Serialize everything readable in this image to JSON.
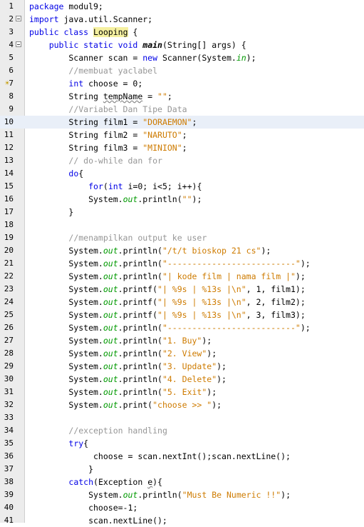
{
  "gutter": {
    "numbers": [
      "1",
      "2",
      "3",
      "4",
      "5",
      "6",
      "7",
      "8",
      "9",
      "10",
      "11",
      "12",
      "13",
      "14",
      "15",
      "16",
      "17",
      "18",
      "19",
      "20",
      "21",
      "22",
      "23",
      "24",
      "25",
      "26",
      "27",
      "28",
      "29",
      "30",
      "31",
      "32",
      "33",
      "34",
      "35",
      "36",
      "37",
      "38",
      "39",
      "40",
      "41"
    ]
  },
  "editor": {
    "highlighted_line": 10,
    "lines": [
      [
        [
          "kw",
          "package"
        ],
        [
          "tx",
          " modul9;"
        ]
      ],
      [
        [
          "kw",
          "import"
        ],
        [
          "tx",
          " java.util.Scanner;"
        ]
      ],
      [
        [
          "kw",
          "public class"
        ],
        [
          "tx",
          " "
        ],
        [
          "hc",
          "Looping"
        ],
        [
          "tx",
          " {"
        ]
      ],
      [
        [
          "tx",
          "    "
        ],
        [
          "kw",
          "public static void"
        ],
        [
          "tx",
          " "
        ],
        [
          "bo",
          "main"
        ],
        [
          "tx",
          "(String[] args) {"
        ]
      ],
      [
        [
          "tx",
          "        Scanner scan = "
        ],
        [
          "kw",
          "new"
        ],
        [
          "tx",
          " Scanner(System."
        ],
        [
          "fi",
          "in"
        ],
        [
          "tx",
          ");"
        ]
      ],
      [
        [
          "tx",
          "        "
        ],
        [
          "cm",
          "//membuat yaclabel"
        ]
      ],
      [
        [
          "tx",
          "        "
        ],
        [
          "kw",
          "int"
        ],
        [
          "tx",
          " choose = 0;"
        ]
      ],
      [
        [
          "tx",
          "        String "
        ],
        [
          "ul",
          "tempName"
        ],
        [
          "tx",
          " = "
        ],
        [
          "st",
          "\"\""
        ],
        [
          "tx",
          ";"
        ]
      ],
      [
        [
          "tx",
          "        "
        ],
        [
          "cm",
          "//Variabel Dan Tipe Data"
        ]
      ],
      [
        [
          "tx",
          "        String film1 = "
        ],
        [
          "st",
          "\"DORAEMON\""
        ],
        [
          "tx",
          ";"
        ]
      ],
      [
        [
          "tx",
          "        String film2 = "
        ],
        [
          "st",
          "\"NARUTO\""
        ],
        [
          "tx",
          ";"
        ]
      ],
      [
        [
          "tx",
          "        String film3 = "
        ],
        [
          "st",
          "\"MINION\""
        ],
        [
          "tx",
          ";"
        ]
      ],
      [
        [
          "tx",
          "        "
        ],
        [
          "cm",
          "// do-while dan for"
        ]
      ],
      [
        [
          "tx",
          "        "
        ],
        [
          "kw",
          "do"
        ],
        [
          "tx",
          "{"
        ]
      ],
      [
        [
          "tx",
          "            "
        ],
        [
          "kw",
          "for"
        ],
        [
          "tx",
          "("
        ],
        [
          "kw",
          "int"
        ],
        [
          "tx",
          " i=0; i<5; i++){"
        ]
      ],
      [
        [
          "tx",
          "            System."
        ],
        [
          "fi",
          "out"
        ],
        [
          "tx",
          ".println("
        ],
        [
          "st",
          "\"\""
        ],
        [
          "tx",
          ");"
        ]
      ],
      [
        [
          "tx",
          "        }"
        ]
      ],
      [
        [
          "tx",
          ""
        ]
      ],
      [
        [
          "tx",
          "        "
        ],
        [
          "cm",
          "//menampilkan output ke user"
        ]
      ],
      [
        [
          "tx",
          "        System."
        ],
        [
          "fi",
          "out"
        ],
        [
          "tx",
          ".println("
        ],
        [
          "st",
          "\"/t/t bioskop 21 cs\""
        ],
        [
          "tx",
          ");"
        ]
      ],
      [
        [
          "tx",
          "        System."
        ],
        [
          "fi",
          "out"
        ],
        [
          "tx",
          ".println("
        ],
        [
          "st",
          "\"--------------------------\""
        ],
        [
          "tx",
          ");"
        ]
      ],
      [
        [
          "tx",
          "        System."
        ],
        [
          "fi",
          "out"
        ],
        [
          "tx",
          ".println("
        ],
        [
          "st",
          "\"| kode film | nama film |\""
        ],
        [
          "tx",
          ");"
        ]
      ],
      [
        [
          "tx",
          "        System."
        ],
        [
          "fi",
          "out"
        ],
        [
          "tx",
          ".printf("
        ],
        [
          "st",
          "\"| %9s | %13s |\\n\""
        ],
        [
          "tx",
          ", 1, film1);"
        ]
      ],
      [
        [
          "tx",
          "        System."
        ],
        [
          "fi",
          "out"
        ],
        [
          "tx",
          ".printf("
        ],
        [
          "st",
          "\"| %9s | %13s |\\n\""
        ],
        [
          "tx",
          ", 2, film2);"
        ]
      ],
      [
        [
          "tx",
          "        System."
        ],
        [
          "fi",
          "out"
        ],
        [
          "tx",
          ".printf("
        ],
        [
          "st",
          "\"| %9s | %13s |\\n\""
        ],
        [
          "tx",
          ", 3, film3);"
        ]
      ],
      [
        [
          "tx",
          "        System."
        ],
        [
          "fi",
          "out"
        ],
        [
          "tx",
          ".println("
        ],
        [
          "st",
          "\"--------------------------\""
        ],
        [
          "tx",
          ");"
        ]
      ],
      [
        [
          "tx",
          "        System."
        ],
        [
          "fi",
          "out"
        ],
        [
          "tx",
          ".println("
        ],
        [
          "st",
          "\"1. Buy\""
        ],
        [
          "tx",
          ");"
        ]
      ],
      [
        [
          "tx",
          "        System."
        ],
        [
          "fi",
          "out"
        ],
        [
          "tx",
          ".println("
        ],
        [
          "st",
          "\"2. View\""
        ],
        [
          "tx",
          ");"
        ]
      ],
      [
        [
          "tx",
          "        System."
        ],
        [
          "fi",
          "out"
        ],
        [
          "tx",
          ".println("
        ],
        [
          "st",
          "\"3. Update\""
        ],
        [
          "tx",
          ");"
        ]
      ],
      [
        [
          "tx",
          "        System."
        ],
        [
          "fi",
          "out"
        ],
        [
          "tx",
          ".println("
        ],
        [
          "st",
          "\"4. Delete\""
        ],
        [
          "tx",
          ");"
        ]
      ],
      [
        [
          "tx",
          "        System."
        ],
        [
          "fi",
          "out"
        ],
        [
          "tx",
          ".println("
        ],
        [
          "st",
          "\"5. Exit\""
        ],
        [
          "tx",
          ");"
        ]
      ],
      [
        [
          "tx",
          "        System."
        ],
        [
          "fi",
          "out"
        ],
        [
          "tx",
          ".print("
        ],
        [
          "st",
          "\"choose >> \""
        ],
        [
          "tx",
          ");"
        ]
      ],
      [
        [
          "tx",
          ""
        ]
      ],
      [
        [
          "tx",
          "        "
        ],
        [
          "cm",
          "//exception handling"
        ]
      ],
      [
        [
          "tx",
          "        "
        ],
        [
          "kw",
          "try"
        ],
        [
          "tx",
          "{"
        ]
      ],
      [
        [
          "tx",
          "             choose = scan.nextInt();scan.nextLine();"
        ]
      ],
      [
        [
          "tx",
          "            }"
        ]
      ],
      [
        [
          "tx",
          "        "
        ],
        [
          "kw",
          "catch"
        ],
        [
          "tx",
          "(Exception "
        ],
        [
          "ul",
          "e"
        ],
        [
          "tx",
          "){"
        ]
      ],
      [
        [
          "tx",
          "            System."
        ],
        [
          "fi",
          "out"
        ],
        [
          "tx",
          ".println("
        ],
        [
          "st",
          "\"Must Be Numeric !!\""
        ],
        [
          "tx",
          ");"
        ]
      ],
      [
        [
          "tx",
          "            choose=-1;"
        ]
      ],
      [
        [
          "tx",
          "            scan.nextLine();"
        ]
      ]
    ]
  },
  "fold_markers": [
    2,
    4
  ],
  "hint_markers": [
    7
  ],
  "colors": {
    "keyword": "#0000e6",
    "comment": "#969696",
    "string": "#ce7b00",
    "static_field": "#009900",
    "current_line": "#e9eff8",
    "class_highlight": "#f5f0a0",
    "gutter_bg": "#ececec"
  },
  "icons": {
    "fold": "minus-box-icon",
    "hint": "lightbulb-icon"
  }
}
